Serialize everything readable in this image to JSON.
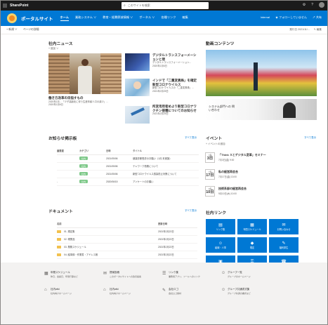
{
  "suite": {
    "app": "SharePoint",
    "search_placeholder": "このサイトを検索"
  },
  "hub": {
    "site": "ポータルサイト",
    "nav": [
      "ホーム",
      "業務システム ∨",
      "教育・経費節減情報 ∨",
      "ポータル ∨",
      "各種リンク",
      "編集"
    ],
    "right": [
      "Internal",
      "★ フォローしていません",
      "↗ 共有"
    ]
  },
  "cmd": {
    "new": "+ 新規 ∨",
    "details": "ページの詳細",
    "published": "発行日 2021/11/...",
    "edit": "✎ 編集"
  },
  "news": {
    "title": "社内ニュース",
    "add": "+ 追加 ∨",
    "main_title": "働き方改革の目指すもの",
    "main_desc": "2020年1月... 「少子高齢化に伴う生産年齢人口の減少」...",
    "main_date": "2020年1月6日",
    "items": [
      {
        "title": "デジタルトランスフォーメーションと現",
        "desc": "デジタルトランスフォーメーション...",
        "date": "2020年1月6日"
      },
      {
        "title": "インドで「二重変異株」を確定 新型コロナウイルス",
        "desc": "新型コロナウイルスの「二重変異株」...",
        "date": "2021年2月25日"
      },
      {
        "title": "所変用用者めより新型コロナワクチン接種についてのお知らせ",
        "desc": "所変用用者めよりの新型コロナワクチン...",
        "date": "2021年2月25日"
      }
    ]
  },
  "video": {
    "title": "動画コンテンツ",
    "caption": "システム部門への 問い合わせ"
  },
  "ann": {
    "title": "お知らせ掲示板",
    "see_all": "すべて表示",
    "headers": [
      "重要度",
      "カテゴリ",
      "日時",
      "タイトル"
    ],
    "rows": [
      {
        "imp": "",
        "cat": "社内",
        "date": "2021/05/06",
        "title": "健康診断受診のお願い（1月 未実施）"
      },
      {
        "imp": "",
        "cat": "社内",
        "date": "2021/05/06",
        "title": "テレワーク勤務について"
      },
      {
        "imp": "",
        "cat": "社内",
        "date": "2021/05/06",
        "title": "新型コロナウイルス感染防止対策について"
      },
      {
        "imp": "-",
        "cat": "社内",
        "date": "2020/06/15",
        "title": "アンケートのお願い"
      }
    ]
  },
  "events": {
    "title": "イベント",
    "see_all": "すべて表示",
    "add": "+ イベントの追加",
    "items": [
      {
        "month": "7月",
        "day": "3日",
        "title": "「Think ３とデジタル変革」セミナー",
        "sub": "7月3日(金) 9:00"
      },
      {
        "month": "7月",
        "day": "17日",
        "title": "私の経営再会合",
        "sub": "7月17日(金) 13:00"
      },
      {
        "month": "9月",
        "day": "10日",
        "title": "技術系部の経営再会合",
        "sub": "9月10日(木) 10:00"
      }
    ]
  },
  "docs": {
    "title": "ドキュメント",
    "see_all": "すべて表示",
    "headers": [
      "名前",
      "更新日時"
    ],
    "rows": [
      {
        "name": "01. 規定集",
        "date": "2021年2月22日"
      },
      {
        "name": "02. 現業品",
        "date": "2021年2月22日"
      },
      {
        "name": "03. 業務スケジュール",
        "date": "2021年2月22日"
      },
      {
        "name": "04. 議事録・作業書・アドレス帳",
        "date": "2021年2月22日"
      }
    ]
  },
  "links": {
    "title": "社内リンク",
    "tiles": [
      {
        "icon": "▤",
        "label": "リンク集"
      },
      {
        "icon": "▦",
        "label": "年間スケジュール"
      },
      {
        "icon": "✉",
        "label": "お問い合わせ"
      },
      {
        "icon": "☺",
        "label": "組織・人事"
      },
      {
        "icon": "◆",
        "label": "規定"
      },
      {
        "icon": "✎",
        "label": "福利厚生"
      },
      {
        "icon": "▣",
        "label": "各種申請書"
      },
      {
        "icon": "⚿",
        "label": "安全情報"
      },
      {
        "icon": "☎",
        "label": "お問い合わせ"
      }
    ]
  },
  "footer": {
    "items": [
      {
        "icon": "▦",
        "title": "年間スケジュール",
        "desc": "休日、会議日、年間行事など"
      },
      {
        "icon": "✉",
        "title": "提案投稿",
        "desc": "このポータルサイトへの改善提案"
      },
      {
        "icon": "☰",
        "title": "リンク集",
        "desc": "業務用アプリ、ツールへのリンク"
      },
      {
        "icon": "☺",
        "title": "グループ一覧",
        "desc": "グループのホームページ"
      },
      {
        "icon": "⌂",
        "title": "社内wiki",
        "desc": "社内向けホームページ"
      },
      {
        "icon": "⌂",
        "title": "社内wiki",
        "desc": "社内向けホームページ"
      },
      {
        "icon": "✎",
        "title": "会社ロゴ",
        "desc": "会社ロゴ素材"
      },
      {
        "icon": "☺",
        "title": "グループ共通書式集",
        "desc": "グループ共通の書式など"
      }
    ]
  }
}
